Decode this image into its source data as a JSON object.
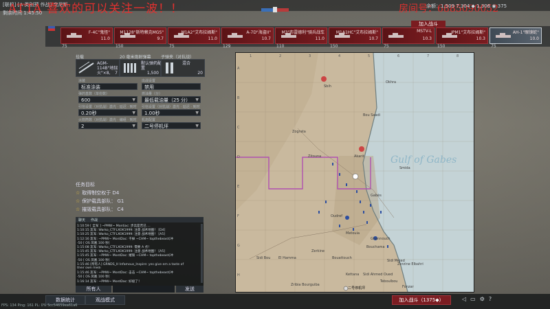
{
  "overlay": {
    "title": "ATTA 喜欢的可以关注一波！！",
    "right": "房间号：6885090052"
  },
  "topbar": {
    "mode": "[联机] [A 类别预 作战] 突尼斯",
    "time": "剩余时间 1:45:50",
    "balance": "余额：1,509 7,304 ◆ 1,306 ◉ 375"
  },
  "vehicles": [
    {
      "name": "F-4C\"鬼怪\"",
      "br": "11.0"
    },
    {
      "name": "M1128\"斯特赖克MGS\"",
      "br": "9.7"
    },
    {
      "name": "M1A2\"艾布拉姆斯\"",
      "br": "11.0"
    },
    {
      "name": "A-7D\"海盗II\"",
      "br": "10.7"
    },
    {
      "name": "M3\"布雷德利\"骑兵战车",
      "br": "11.0"
    },
    {
      "name": "M1A1HC\"艾布拉姆斯\"",
      "br": "10.7"
    },
    {
      "name": "MSTV-L",
      "br": "10.3"
    },
    {
      "name": "IPM1\"艾布拉姆斯\"",
      "br": "10.3"
    },
    {
      "name": "AH-1\"眼镜蛇\"",
      "br": "10.0"
    }
  ],
  "slot_costs": [
    "75",
    "150",
    "75",
    "129",
    "110",
    "150",
    "75",
    "150",
    "75"
  ],
  "join_top": "加入战斗",
  "loadout": {
    "h1": "挂载",
    "h2": "20 毫米炮射弹幕",
    "h3": "子弹夹（对抗战）",
    "w1": "AGM-114B\"地狱火\"×8,",
    "w1c": "7",
    "w2": "默认弹药配置",
    "w2c": "1,500",
    "w3": "混合",
    "w3c": "20",
    "l1": "涂装",
    "v1": "标准涂装",
    "l2": "出战设置",
    "v2": "禁用",
    "l3": "弹药基数（单份数）",
    "v3": "600",
    "l4": "燃油量（分）",
    "v4": "最低载油量（25 分）",
    "l5": "引信设置（对抗战）激光 · 延迟 · 到时",
    "v5": "0.20秒",
    "l6": "引信设置（对抗战）激光 · 延迟 · 到时",
    "v6": "1.00秒",
    "l7": "火箭筒数（对抗战）激光 · 编组 · 到时",
    "v7": "2",
    "l8": "机炮配置",
    "v8": "二号停机坪"
  },
  "mission": {
    "title": "任务目标",
    "obj1": "取得制空权于 D4",
    "obj2": "保护载具部队： G1",
    "obj3": "摧毁载具部队： C4"
  },
  "chat": {
    "tab1": "聊天",
    "tab2": "作战",
    "lines": [
      "1:10:59 [ 全军 ] ~PMW~ Montiac: 步兵是否已 ...",
      "1:10:15 友军: Warko_CTFLXOK1999: 注意 战术地图！ [D4]",
      "1:10:25 友军: Warko_CTFLXOK1999: 注意 战术地图！ [A5]",
      "1:12:16 友军: ~PMW~ MontDac: 干掉 ~CHM~ topthebeast(冲",
      "  -50 [ OS 凤凰 100 秒]",
      "1:15:08 友军: Warko_CTFLXOK1999: 需要 A 点！",
      "1:15:45 友军: Warko_CTFLXOK1999: 注意 战术地图！ [A5]",
      "1:15:45 友军: ~PMW~ MontDac: 摧毁 ~CHM~ topthebeast(冲",
      "  -50 [ OS 凤凰 100 秒]",
      "1:15:46 [所有人] GRNDS_H Infamous_Inspire: yes give em a taste of",
      "  their own medi",
      "1:15:46 友军: ~PMW~ MontDac: 击击 ~CHM~ topthebeast(冲",
      "  -50 [ OS 凤凰 100 秒]",
      "1:16:14 友军: ~PMW~ MontDac: 好极了！"
    ]
  },
  "chat_bar": {
    "all": "所有人",
    "send": "发送"
  },
  "map": {
    "cols": [
      "1",
      "2",
      "3",
      "4",
      "5",
      "6",
      "7",
      "8"
    ],
    "rows": [
      "A",
      "B",
      "C",
      "D",
      "E",
      "F",
      "G",
      "H"
    ],
    "sea": "Gulf of Gabes",
    "cities": [
      {
        "n": "Sbih"
      },
      {
        "n": "Okhra"
      },
      {
        "n": "Bou Saadi"
      },
      {
        "n": "Zograta"
      },
      {
        "n": "Zitouna"
      },
      {
        "n": "Akarit"
      },
      {
        "n": "Smida"
      },
      {
        "n": "Gabès"
      },
      {
        "n": "Oudref"
      },
      {
        "n": "Metouia"
      },
      {
        "n": "Ghannouch"
      },
      {
        "n": "Bouchama"
      },
      {
        "n": "Sidi Mejed"
      },
      {
        "n": "Zerkine"
      },
      {
        "n": "Bouattouch"
      },
      {
        "n": "El Hamma"
      },
      {
        "n": "Sidi Bou"
      },
      {
        "n": "Kettana"
      },
      {
        "n": "Zribia Bourguiba"
      },
      {
        "n": "Zerzine Elbahri"
      },
      {
        "n": "Sidi Ahmed Oued"
      },
      {
        "n": "Teboulbou"
      },
      {
        "n": "Fonzar"
      }
    ],
    "footer": "二号停机坪"
  },
  "bottom": {
    "stats": "数据统计",
    "observe": "观战模式",
    "join": "加入战斗（1375◆）"
  },
  "fps": "FPS: 134   Ping: 161   PL: 0%   5cc54659ea61a6",
  "colors": {
    "enemy_slot": "#7a1c20",
    "accent": "#e0312f",
    "blue_team": "#3a6fb8",
    "red_team": "#b83a3a"
  }
}
